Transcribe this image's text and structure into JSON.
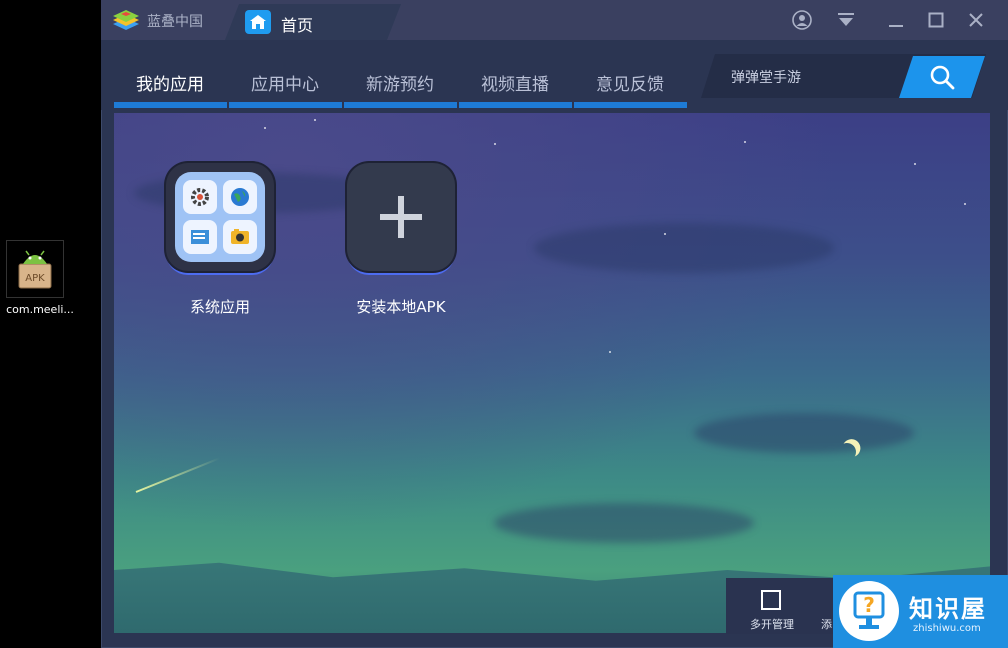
{
  "desktop": {
    "icon_label": "com.meeli...",
    "icon_badge": "APK"
  },
  "window": {
    "brand": "蓝叠中国",
    "tab_title": "首页"
  },
  "nav": {
    "tabs": [
      {
        "label": "我的应用",
        "active": true
      },
      {
        "label": "应用中心",
        "active": false
      },
      {
        "label": "新游预约",
        "active": false
      },
      {
        "label": "视频直播",
        "active": false
      },
      {
        "label": "意见反馈",
        "active": false
      }
    ]
  },
  "search": {
    "placeholder": "弹弹堂手游"
  },
  "apps": [
    {
      "label": "系统应用",
      "icon": "system-apps-folder-icon"
    },
    {
      "label": "安装本地APK",
      "icon": "plus-icon"
    }
  ],
  "bottom_bar": {
    "multi_label": "多开管理",
    "partial_label": "添"
  },
  "watermark": {
    "title": "知识屋",
    "subtitle": "zhishiwu.com"
  },
  "colors": {
    "accent": "#1c94ec",
    "tab_underline": "#1e7bd6",
    "titlebar": "#3a4060",
    "navbar": "#2b3552"
  }
}
